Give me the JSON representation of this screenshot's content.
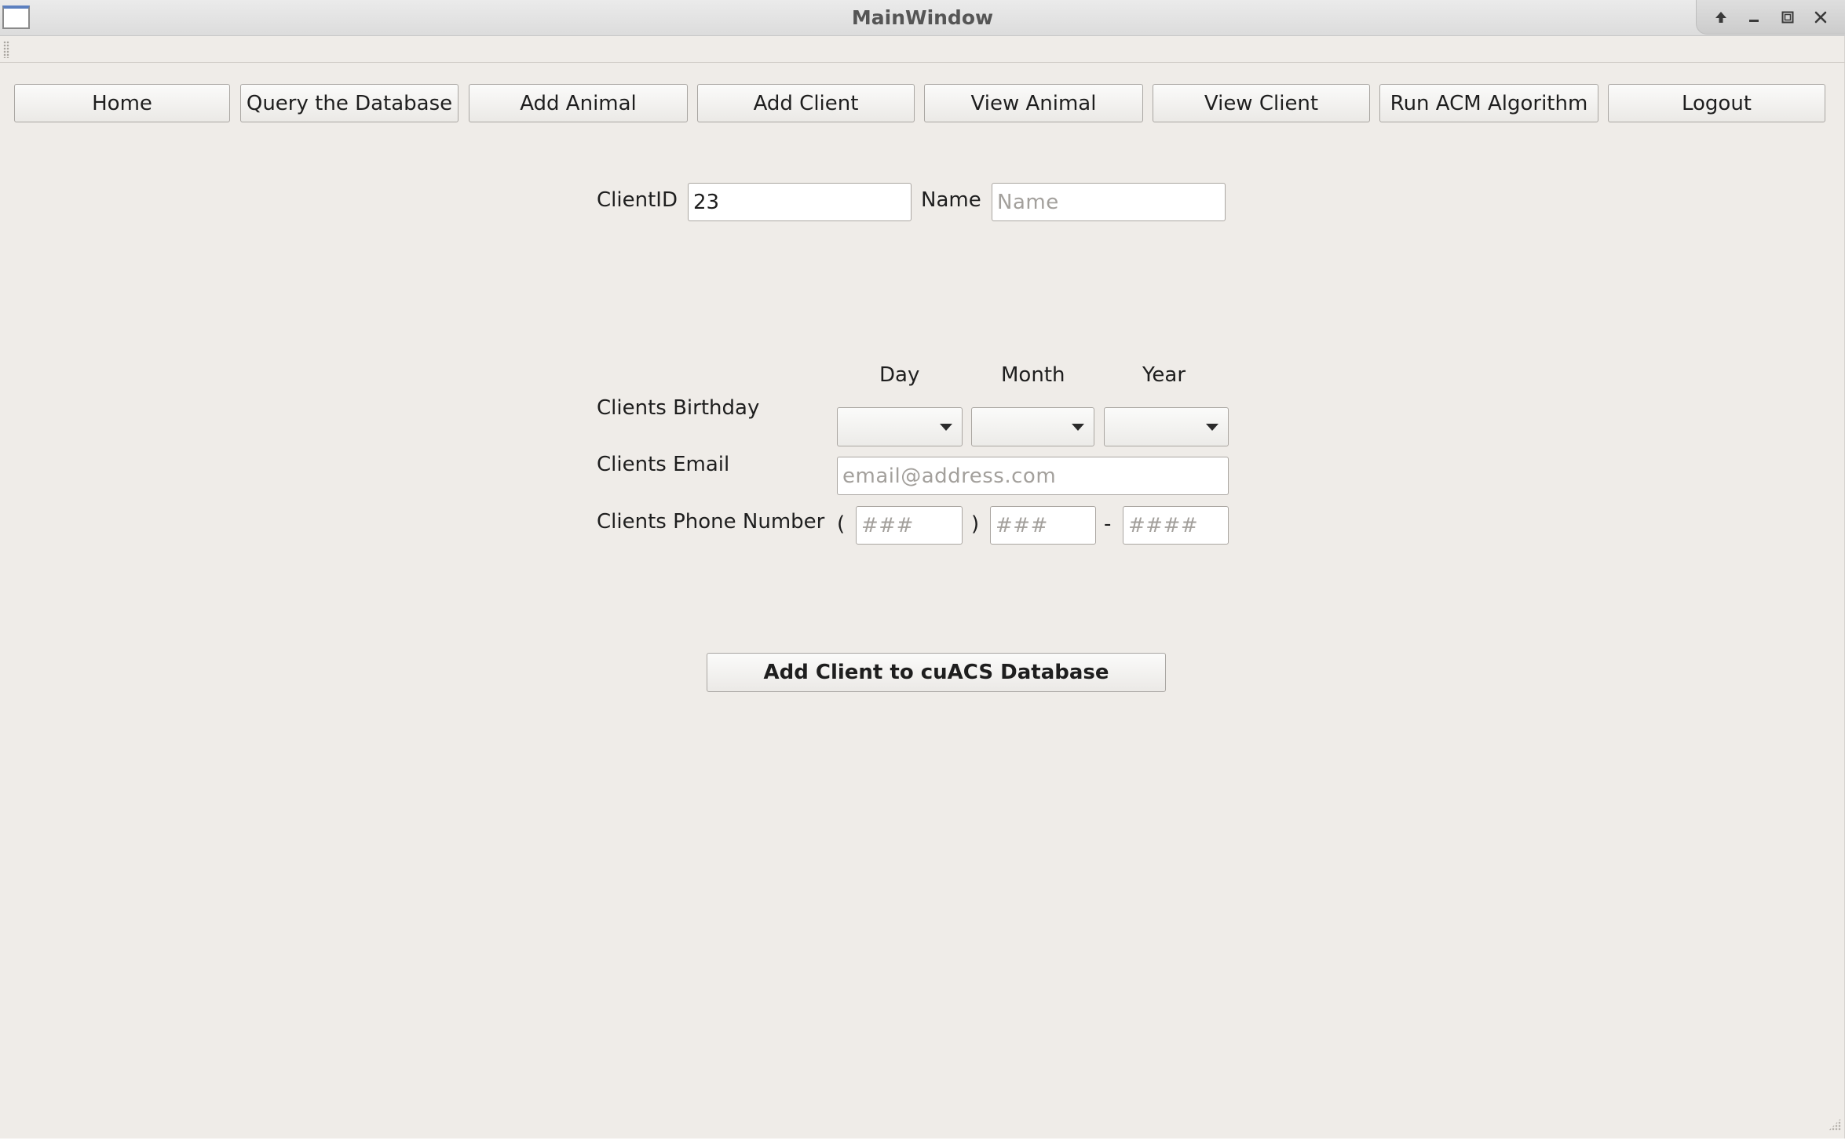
{
  "window": {
    "title": "MainWindow"
  },
  "nav": {
    "buttons": [
      {
        "label": "Home"
      },
      {
        "label": "Query the Database"
      },
      {
        "label": "Add Animal"
      },
      {
        "label": "Add Client"
      },
      {
        "label": "View Animal"
      },
      {
        "label": "View Client"
      },
      {
        "label": "Run ACM Algorithm"
      },
      {
        "label": "Logout"
      }
    ]
  },
  "form": {
    "client_id_label": "ClientID",
    "client_id_value": "23",
    "name_label": "Name",
    "name_placeholder": "Name",
    "birthday": {
      "label": "Clients Birthday",
      "day_label": "Day",
      "month_label": "Month",
      "year_label": "Year",
      "day_value": "",
      "month_value": "",
      "year_value": ""
    },
    "email": {
      "label": "Clients Email",
      "placeholder": "email@address.com"
    },
    "phone": {
      "label": "Clients Phone Number",
      "open_paren": "(",
      "close_paren": ")",
      "dash": "-",
      "area_placeholder": "###",
      "prefix_placeholder": "###",
      "line_placeholder": "####"
    },
    "submit_label": "Add Client to cuACS Database"
  }
}
